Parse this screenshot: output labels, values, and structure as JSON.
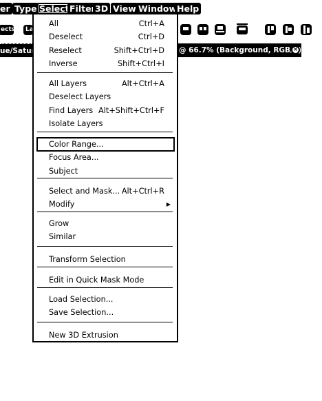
{
  "menubar": {
    "items": [
      "er",
      "Type",
      "Select",
      "Filter",
      "3D",
      "View",
      "Window",
      "Help"
    ],
    "active": "Select"
  },
  "options_bar": {
    "left_pill": "ects",
    "second_pill": "La",
    "icons": [
      "align-top-icon",
      "align-vcenter-icon",
      "align-bottom-icon",
      "distribute-icon",
      "align-left-icon",
      "align-hcenter-icon",
      "align-right-icon"
    ]
  },
  "tabs": {
    "left_tab_text": "ue/Satura",
    "right_tab_text": "@ 66.7% (Background, RGB/8)",
    "close_glyph": "×"
  },
  "menu": {
    "groups": [
      [
        {
          "label": "All",
          "shortcut": "Ctrl+A"
        },
        {
          "label": "Deselect",
          "shortcut": "Ctrl+D"
        },
        {
          "label": "Reselect",
          "shortcut": "Shift+Ctrl+D"
        },
        {
          "label": "Inverse",
          "shortcut": "Shift+Ctrl+I"
        }
      ],
      [
        {
          "label": "All Layers",
          "shortcut": "Alt+Ctrl+A"
        },
        {
          "label": "Deselect Layers",
          "shortcut": ""
        },
        {
          "label": "Find Layers",
          "shortcut": "Alt+Shift+Ctrl+F"
        },
        {
          "label": "Isolate Layers",
          "shortcut": ""
        }
      ],
      [
        {
          "label": "Color Range...",
          "shortcut": "",
          "highlighted": true
        },
        {
          "label": "Focus Area...",
          "shortcut": ""
        },
        {
          "label": "Subject",
          "shortcut": ""
        }
      ],
      [
        {
          "label": "Select and Mask...",
          "shortcut": "Alt+Ctrl+R"
        },
        {
          "label": "Modify",
          "shortcut": "",
          "submenu": true
        }
      ],
      [
        {
          "label": "Grow",
          "shortcut": ""
        },
        {
          "label": "Similar",
          "shortcut": ""
        }
      ],
      [
        {
          "label": "Transform Selection",
          "shortcut": ""
        }
      ],
      [
        {
          "label": "Edit in Quick Mask Mode",
          "shortcut": ""
        }
      ],
      [
        {
          "label": "Load Selection...",
          "shortcut": ""
        },
        {
          "label": "Save Selection...",
          "shortcut": ""
        }
      ],
      [
        {
          "label": "New 3D Extrusion",
          "shortcut": ""
        }
      ]
    ],
    "submenu_arrow": "▶"
  }
}
